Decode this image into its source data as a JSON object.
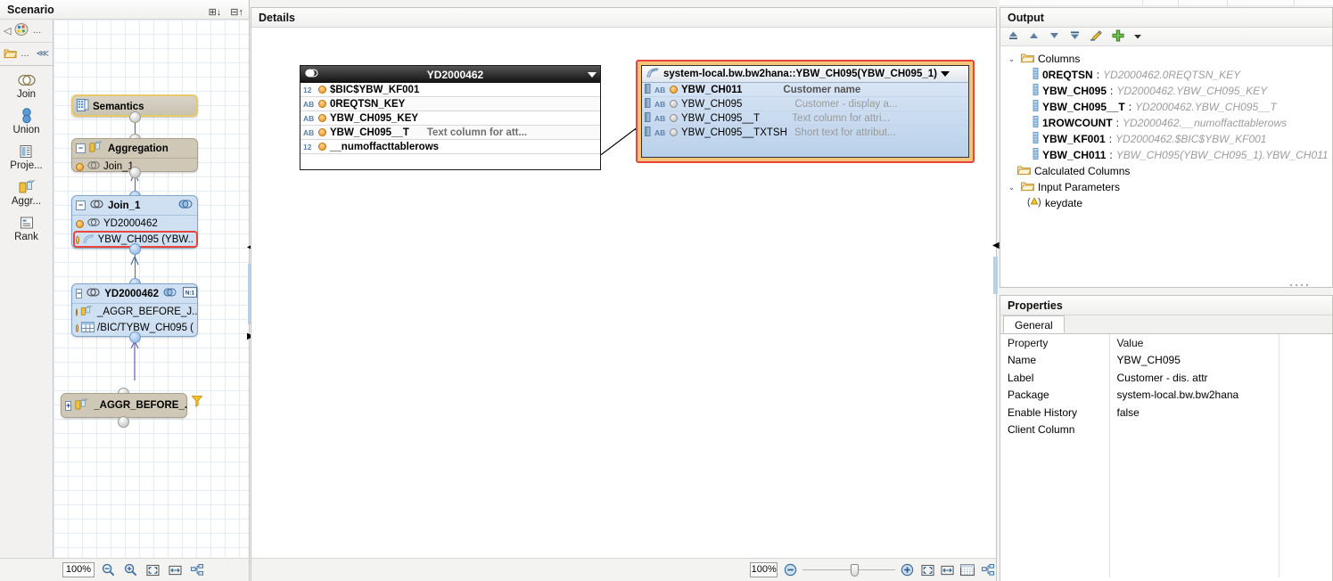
{
  "scenario": {
    "title": "Scenario",
    "header_icons": [
      {
        "name": "expand-all-icon",
        "glyph": "⊞↓"
      },
      {
        "name": "collapse-all-icon",
        "glyph": "⊟↑"
      }
    ],
    "palette_rows": [
      {
        "name": "pointer-tool",
        "glyph": "◁",
        "extra": "…",
        "palette_icon": "palette-icon"
      },
      {
        "name": "folder-tool",
        "glyph": "…",
        "extra": "⋘"
      }
    ],
    "palette_items": [
      {
        "label": "Join",
        "icon": "join-icon"
      },
      {
        "label": "Union",
        "icon": "union-icon"
      },
      {
        "label": "Proje...",
        "icon": "projection-icon"
      },
      {
        "label": "Aggr...",
        "icon": "aggregation-icon"
      },
      {
        "label": "Rank",
        "icon": "rank-icon"
      }
    ],
    "nodes": [
      {
        "id": "semantics",
        "title": "Semantics",
        "icon": "semantics-icon",
        "rows": []
      },
      {
        "id": "aggregation",
        "title": "Aggregation",
        "icon": "aggregation-icon",
        "expander": "−",
        "rows": [
          {
            "label": "Join_1",
            "icon": "join-icon"
          }
        ]
      },
      {
        "id": "join1",
        "title": "Join_1",
        "icon": "join-icon",
        "expander": "−",
        "badge": "join-type-icon",
        "rows": [
          {
            "label": "YD2000462",
            "icon": "join-icon"
          },
          {
            "label": "YBW_CH095 (YBW..",
            "icon": "attribute-view-icon",
            "selected": true
          }
        ]
      },
      {
        "id": "yd2000462",
        "title": "YD2000462",
        "icon": "join-icon",
        "expander": "−",
        "badge": "join-type-icon",
        "badge2": "cardinality-n1-icon",
        "rows": [
          {
            "label": "_AGGR_BEFORE_J..",
            "icon": "aggregation-icon"
          },
          {
            "label": "/BIC/TYBW_CH095 (",
            "icon": "table-icon"
          }
        ]
      },
      {
        "id": "aggr_before",
        "title": "_AGGR_BEFORE_.",
        "icon": "aggregation-icon",
        "expander": "+",
        "filter": "filter-icon",
        "rows": []
      }
    ],
    "zoom": {
      "value": "100%",
      "buttons": [
        {
          "name": "zoom-out-button",
          "glyph": "⊖"
        },
        {
          "name": "zoom-in-button",
          "glyph": "⊕"
        },
        {
          "name": "fit-page-button",
          "glyph": "⛶"
        },
        {
          "name": "fit-width-button",
          "glyph": "↔"
        },
        {
          "name": "layout-button",
          "glyph": "⌘"
        }
      ]
    }
  },
  "details": {
    "title": "Details",
    "left_node": {
      "title": "YD2000462",
      "icon": "join-icon",
      "dropdown": "chevron-down-icon",
      "columns": [
        {
          "type": "12",
          "name": "$BIC$YBW_KF001",
          "desc": "",
          "bullet": "orange"
        },
        {
          "type": "AB",
          "name": "0REQTSN_KEY",
          "desc": "",
          "bullet": "orange"
        },
        {
          "type": "AB",
          "name": "YBW_CH095_KEY",
          "desc": "",
          "bullet": "orange"
        },
        {
          "type": "AB",
          "name": "YBW_CH095__T",
          "desc": "Text column for att...",
          "bullet": "orange"
        },
        {
          "type": "12",
          "name": "__numoffacttablerows",
          "desc": "",
          "bullet": "orange"
        }
      ]
    },
    "right_node": {
      "title": "system-local.bw.bw2hana::YBW_CH095(YBW_CH095_1)",
      "icon": "attribute-view-icon",
      "dropdown": "chevron-down-icon",
      "columns": [
        {
          "type": "AB",
          "name": "YBW_CH011",
          "desc": "Customer name",
          "bullet": "orange",
          "bold": true
        },
        {
          "type": "AB",
          "name": "YBW_CH095",
          "desc": "Customer - display a...",
          "bullet": "gray"
        },
        {
          "type": "AB",
          "name": "YBW_CH095__T",
          "desc": "Text column for attri...",
          "bullet": "gray"
        },
        {
          "type": "AB",
          "name": "YBW_CH095__TXTSH",
          "desc": "Short text for attribut...",
          "bullet": "gray"
        }
      ]
    },
    "zoom": {
      "value": "100%",
      "buttons": [
        {
          "name": "zoom-out-button",
          "glyph": "⊖"
        },
        {
          "name": "zoom-in-button",
          "glyph": "⊕"
        },
        {
          "name": "fit-page-button",
          "glyph": "⛶"
        },
        {
          "name": "fit-width-button",
          "glyph": "↔"
        },
        {
          "name": "show-grid-button",
          "glyph": "⌸"
        },
        {
          "name": "layout-button",
          "glyph": "⌘"
        }
      ]
    }
  },
  "output": {
    "title": "Output",
    "toolbar": [
      {
        "name": "move-to-top-button",
        "glyph": "⏫"
      },
      {
        "name": "move-up-button",
        "glyph": "▲"
      },
      {
        "name": "move-down-button",
        "glyph": "▼"
      },
      {
        "name": "move-to-bottom-button",
        "glyph": "⏬"
      },
      {
        "name": "edit-button",
        "glyph": "✎"
      },
      {
        "name": "add-button",
        "glyph": "✚"
      },
      {
        "name": "add-dropdown-button",
        "glyph": "▾"
      }
    ],
    "tree": [
      {
        "level": 0,
        "twisty": "⌄",
        "icon": "folder-icon",
        "label": "Columns",
        "kind": "folder"
      },
      {
        "level": 1,
        "icon": "column-icon",
        "label": "0REQTSN",
        "ref": "YD2000462.0REQTSN_KEY",
        "kind": "column"
      },
      {
        "level": 1,
        "icon": "column-icon",
        "label": "YBW_CH095",
        "ref": "YD2000462.YBW_CH095_KEY",
        "kind": "column"
      },
      {
        "level": 1,
        "icon": "column-icon",
        "label": "YBW_CH095__T",
        "ref": "YD2000462.YBW_CH095__T",
        "kind": "column"
      },
      {
        "level": 1,
        "icon": "column-icon",
        "label": "1ROWCOUNT",
        "ref": "YD2000462.__numoffacttablerows",
        "kind": "column"
      },
      {
        "level": 1,
        "icon": "column-icon",
        "label": "YBW_KF001",
        "ref": "YD2000462.$BIC$YBW_KF001",
        "kind": "column"
      },
      {
        "level": 1,
        "icon": "column-icon",
        "label": "YBW_CH011",
        "ref": "YBW_CH095(YBW_CH095_1).YBW_CH011",
        "kind": "column"
      },
      {
        "level": 0,
        "icon": "folder-icon",
        "label": "Calculated Columns",
        "kind": "folder"
      },
      {
        "level": 0,
        "twisty": "⌄",
        "icon": "folder-icon",
        "label": "Input Parameters",
        "kind": "folder"
      },
      {
        "level": 1,
        "icon": "parameter-icon",
        "label": "keydate",
        "kind": "parameter"
      }
    ]
  },
  "properties": {
    "title": "Properties",
    "tabs": [
      {
        "label": "General",
        "active": true
      }
    ],
    "headers": [
      "Property",
      "Value"
    ],
    "rows": [
      {
        "property": "Name",
        "value": "YBW_CH095"
      },
      {
        "property": "Label",
        "value": "Customer - dis. attr"
      },
      {
        "property": "Package",
        "value": "system-local.bw.bw2hana"
      },
      {
        "property": "Enable History",
        "value": "false"
      },
      {
        "property": "Client Column",
        "value": ""
      }
    ]
  },
  "colors": {
    "selection_red": "#e8453c",
    "selection_orange": "#f4c47b",
    "join_blue": "#cfe0f3",
    "aggregation_tan": "#cfc8b6"
  }
}
